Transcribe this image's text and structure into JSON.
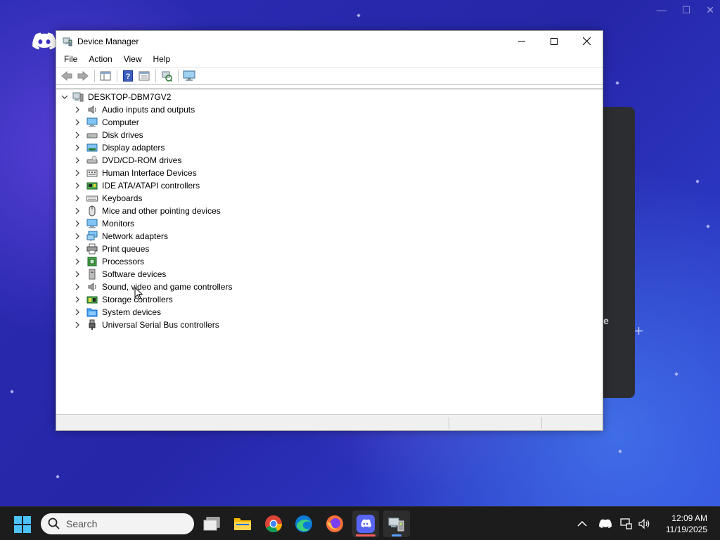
{
  "window": {
    "title": "Device Manager",
    "menu": [
      "File",
      "Action",
      "View",
      "Help"
    ],
    "root": "DESKTOP-DBM7GV2",
    "categories": [
      {
        "label": "Audio inputs and outputs",
        "icon": "speaker-icon"
      },
      {
        "label": "Computer",
        "icon": "computer-icon"
      },
      {
        "label": "Disk drives",
        "icon": "disk-drive-icon"
      },
      {
        "label": "Display adapters",
        "icon": "display-adapter-icon"
      },
      {
        "label": "DVD/CD-ROM drives",
        "icon": "dvd-drive-icon"
      },
      {
        "label": "Human Interface Devices",
        "icon": "hid-icon"
      },
      {
        "label": "IDE ATA/ATAPI controllers",
        "icon": "ide-controller-icon"
      },
      {
        "label": "Keyboards",
        "icon": "keyboard-icon"
      },
      {
        "label": "Mice and other pointing devices",
        "icon": "mouse-icon"
      },
      {
        "label": "Monitors",
        "icon": "monitor-icon"
      },
      {
        "label": "Network adapters",
        "icon": "network-adapter-icon"
      },
      {
        "label": "Print queues",
        "icon": "printer-icon"
      },
      {
        "label": "Processors",
        "icon": "processor-icon"
      },
      {
        "label": "Software devices",
        "icon": "software-device-icon"
      },
      {
        "label": "Sound, video and game controllers",
        "icon": "speaker-icon"
      },
      {
        "label": "Storage controllers",
        "icon": "storage-controller-icon"
      },
      {
        "label": "System devices",
        "icon": "system-folder-icon"
      },
      {
        "label": "Universal Serial Bus controllers",
        "icon": "usb-icon"
      }
    ]
  },
  "background": {
    "panel_text": "e"
  },
  "taskbar": {
    "search_placeholder": "Search",
    "time": "12:09 AM",
    "date": "11/19/2025"
  },
  "colors": {
    "taskbar": "#1c1c1c",
    "accent": "#0078d4",
    "discord": "#5865f2"
  }
}
